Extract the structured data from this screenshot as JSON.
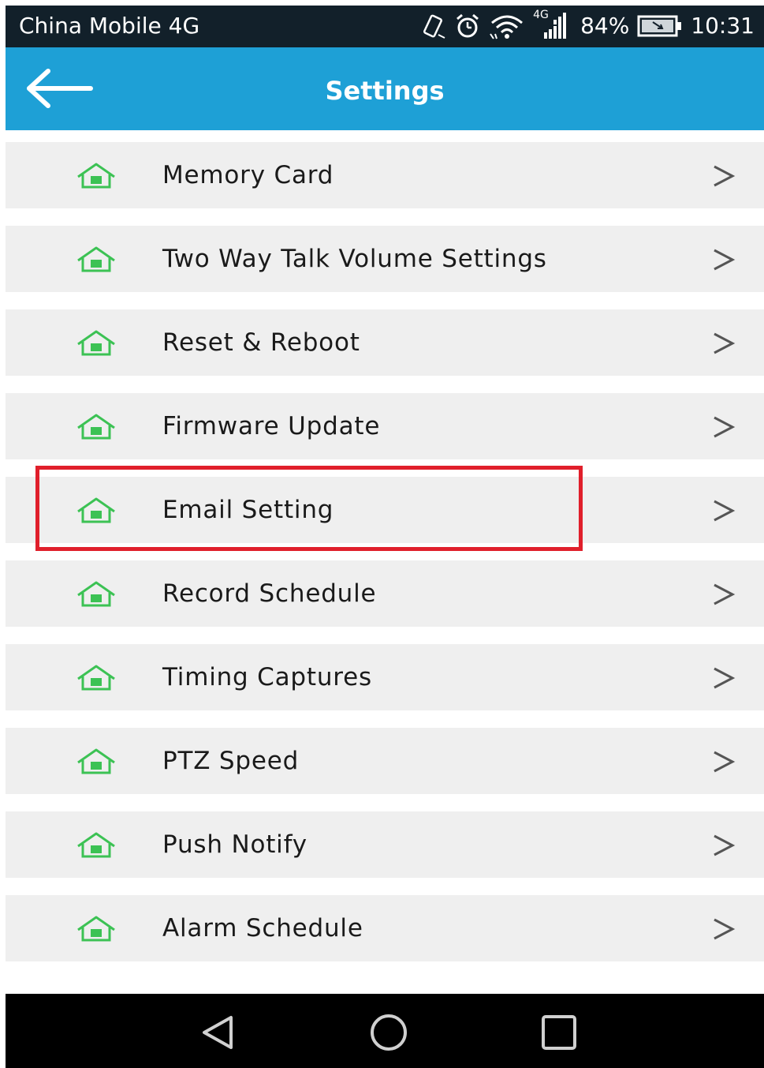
{
  "status_bar": {
    "carrier": "China Mobile 4G",
    "network_type": "4G",
    "battery_percent": "84%",
    "time": "10:31",
    "icons": [
      "vibrate-icon",
      "alarm-icon",
      "wifi-icon",
      "signal-icon",
      "battery-icon"
    ]
  },
  "app_bar": {
    "title": "Settings",
    "back_icon": "arrow-left-icon"
  },
  "settings": {
    "items": [
      {
        "label": "Memory Card",
        "icon": "home-icon",
        "chevron": ">"
      },
      {
        "label": "Two Way Talk Volume Settings",
        "icon": "home-icon",
        "chevron": ">"
      },
      {
        "label": "Reset & Reboot",
        "icon": "home-icon",
        "chevron": ">"
      },
      {
        "label": "Firmware Update",
        "icon": "home-icon",
        "chevron": ">"
      },
      {
        "label": "Email Setting",
        "icon": "home-icon",
        "chevron": ">",
        "highlighted": true
      },
      {
        "label": "Record Schedule",
        "icon": "home-icon",
        "chevron": ">"
      },
      {
        "label": "Timing Captures",
        "icon": "home-icon",
        "chevron": ">"
      },
      {
        "label": "PTZ Speed",
        "icon": "home-icon",
        "chevron": ">"
      },
      {
        "label": "Push Notify",
        "icon": "home-icon",
        "chevron": ">"
      },
      {
        "label": "Alarm Schedule",
        "icon": "home-icon",
        "chevron": ">"
      }
    ]
  },
  "nav_bar": {
    "buttons": [
      "back-triangle-icon",
      "home-circle-icon",
      "recents-square-icon"
    ]
  },
  "colors": {
    "status_bar": "#12202a",
    "app_bar": "#1ea0d6",
    "list_item_bg": "#efefef",
    "icon_green": "#3cc254",
    "highlight": "#e01f2b",
    "nav_bar": "#000000"
  }
}
